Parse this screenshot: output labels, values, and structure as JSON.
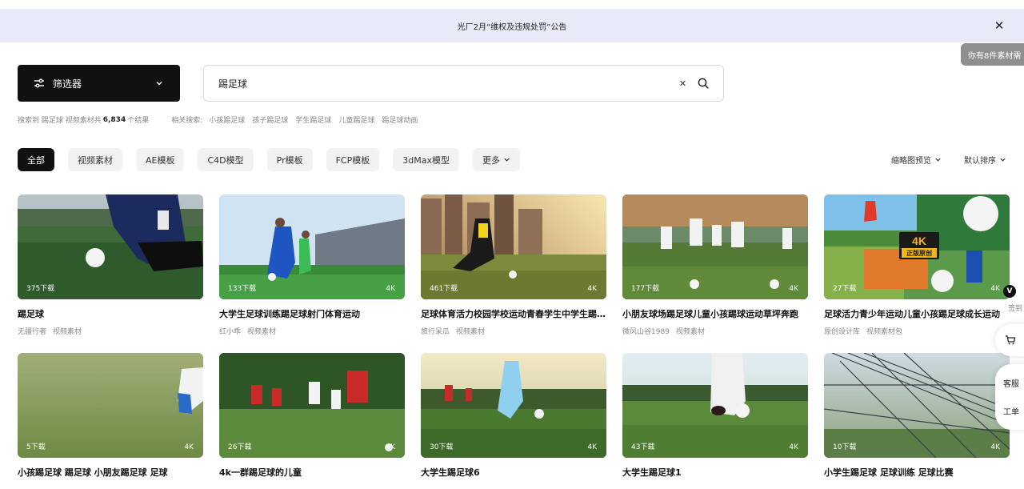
{
  "banner": {
    "text": "光厂2月“维权及违规处罚”公告"
  },
  "upload_hint": "你有8件素材需",
  "filter": {
    "label": "筛选器"
  },
  "search": {
    "value": "踢足球"
  },
  "results": {
    "prefix": "搜索到 踢足球 视频素材共",
    "count": "6,834",
    "suffix": "个结果",
    "related_label": "相关搜索:",
    "related": [
      "小孩踢足球",
      "孩子踢足球",
      "学生踢足球",
      "儿童踢足球",
      "踢足球动画"
    ]
  },
  "tabs": [
    "全部",
    "视频素材",
    "AE模板",
    "C4D模型",
    "Pr模板",
    "FCP模板",
    "3dMax模型",
    "更多"
  ],
  "view": {
    "preview": "缩略图预览",
    "sort": "默认排序"
  },
  "side": {
    "vip": "V",
    "sign": "签到",
    "service": "客服",
    "ticket": "工单"
  },
  "cards": [
    {
      "downloads": "375下载",
      "res": "",
      "title": "踢足球",
      "author": "无疆行者",
      "type": "视频素材"
    },
    {
      "downloads": "133下载",
      "res": "4K",
      "title": "大学生足球训练踢足球射门体育运动",
      "author": "红小乖",
      "type": "视频素材"
    },
    {
      "downloads": "461下载",
      "res": "4K",
      "title": "足球体育活力校园学校运动青春学生中学生踢足球",
      "author": "旅行呆瓜",
      "type": "视频素材"
    },
    {
      "downloads": "177下载",
      "res": "4K",
      "title": "小朋友球场踢足球儿童小孩踢球运动草坪奔跑",
      "author": "微风山谷1989",
      "type": "视频素材"
    },
    {
      "downloads": "27下载",
      "res": "4K",
      "title": "足球活力青少年运动儿童小孩踢足球成长运动",
      "author": "原创设计库",
      "type": "视频素材包"
    },
    {
      "downloads": "5下载",
      "res": "4K",
      "title": "小孩踢足球 踢足球 小朋友踢足球 足球",
      "author": "",
      "type": ""
    },
    {
      "downloads": "26下载",
      "res": "4K",
      "title": "4k一群踢足球的儿童",
      "author": "",
      "type": ""
    },
    {
      "downloads": "30下载",
      "res": "4K",
      "title": "大学生踢足球6",
      "author": "",
      "type": ""
    },
    {
      "downloads": "43下载",
      "res": "4K",
      "title": "大学生踢足球1",
      "author": "",
      "type": ""
    },
    {
      "downloads": "10下载",
      "res": "4K",
      "title": "小学生踢足球 足球训练 足球比赛",
      "author": "",
      "type": ""
    }
  ],
  "badge": {
    "line1": "4K",
    "line2": "正版原创"
  },
  "colors": {
    "banner_bg": "#e8ebf7",
    "primary": "#111111",
    "muted": "#888888"
  }
}
